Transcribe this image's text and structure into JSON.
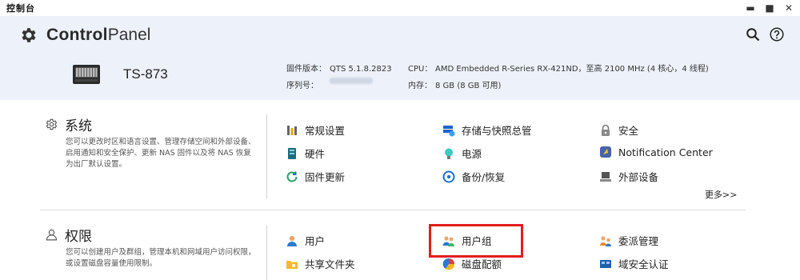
{
  "window": {
    "title": "控制台",
    "controls": {
      "minimize": "▬",
      "maximize": "■",
      "close": "✕"
    }
  },
  "header": {
    "logo_bold": "Control",
    "logo_light": "Panel"
  },
  "device": {
    "model": "TS-873",
    "firmware_label": "固件版本：",
    "firmware_value": "QTS 5.1.8.2823",
    "serial_label": "序列号：",
    "cpu_label": "CPU：",
    "cpu_value": "AMD Embedded R-Series RX-421ND，至高 2100 MHz (4 核心，4 线程)",
    "memory_label": "内存：",
    "memory_value": "8 GB (8 GB 可用)"
  },
  "system": {
    "title": "系统",
    "description": "您可以更改时区和语言设置、管理存储空间和外部设备、启用通知和安全保护、更新 NAS 固件以及将 NAS 恢复为出厂默认设置。",
    "items": [
      {
        "label": "常规设置",
        "icon": "general-settings-icon"
      },
      {
        "label": "存储与快照总管",
        "icon": "storage-icon"
      },
      {
        "label": "安全",
        "icon": "lock-icon"
      },
      {
        "label": "硬件",
        "icon": "hardware-icon"
      },
      {
        "label": "电源",
        "icon": "power-icon"
      },
      {
        "label": "Notification Center",
        "icon": "notification-icon"
      },
      {
        "label": "固件更新",
        "icon": "firmware-update-icon"
      },
      {
        "label": "备份/恢复",
        "icon": "backup-icon"
      },
      {
        "label": "外部设备",
        "icon": "external-device-icon"
      }
    ],
    "more": "更多>>"
  },
  "privilege": {
    "title": "权限",
    "description": "您可以创建用户及群组，管理本机和网域用户访问权限，或设置磁盘容量使用限制。",
    "items": [
      {
        "label": "用户",
        "icon": "user-icon"
      },
      {
        "label": "用户组",
        "icon": "user-group-icon"
      },
      {
        "label": "委派管理",
        "icon": "delegate-icon"
      },
      {
        "label": "共享文件夹",
        "icon": "shared-folder-icon"
      },
      {
        "label": "磁盘配额",
        "icon": "quota-icon"
      },
      {
        "label": "域安全认证",
        "icon": "domain-icon"
      }
    ]
  },
  "colors": {
    "header_bg": "#edf2fa",
    "highlight": "#e31d1d"
  }
}
